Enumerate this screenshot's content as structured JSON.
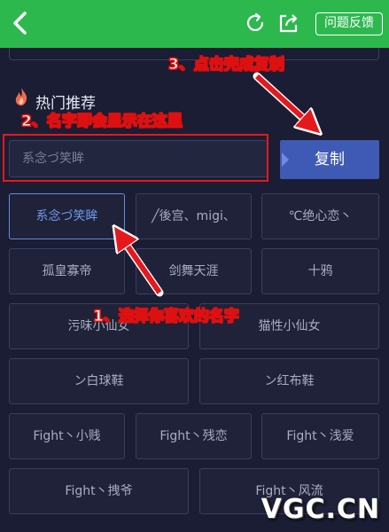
{
  "topbar": {
    "feedback_label": "问题反馈",
    "icons": [
      "back-icon",
      "refresh-icon",
      "share-icon"
    ],
    "color": "#2db84e"
  },
  "section": {
    "title": "热门推荐",
    "icon": "flame-icon"
  },
  "name_input": {
    "value": "系念づ笑眸"
  },
  "copy_button": {
    "label": "复制",
    "color": "#3e5ab5"
  },
  "names": [
    {
      "label": "系念づ笑眸",
      "selected": true
    },
    {
      "label": "╱後宫、migi、",
      "selected": false
    },
    {
      "label": "℃绝心恋丶",
      "selected": false
    },
    {
      "label": "孤皇寡帝",
      "selected": false
    },
    {
      "label": "剑舞天涯",
      "selected": false
    },
    {
      "label": "十鸦",
      "selected": false
    },
    {
      "label": "污味小仙女",
      "selected": false
    },
    {
      "label": "猫性小仙女",
      "selected": false
    },
    {
      "label": "ン白球鞋",
      "selected": false
    },
    {
      "label": "ン红布鞋",
      "selected": false
    },
    {
      "label": "Fight丶小贱",
      "selected": false
    },
    {
      "label": "Fight丶残恋",
      "selected": false
    },
    {
      "label": "Fight丶浅爱",
      "selected": false
    },
    {
      "label": "Fight丶拽爷",
      "selected": false
    },
    {
      "label": "Fight丶风流",
      "selected": false
    }
  ],
  "annotations": {
    "step1": "1、选择你喜欢的名字",
    "step2": "2、名字即会显示在这里",
    "step3": "3、点击完成复制",
    "color": "#e5191d"
  },
  "watermark": "VGC.CN"
}
